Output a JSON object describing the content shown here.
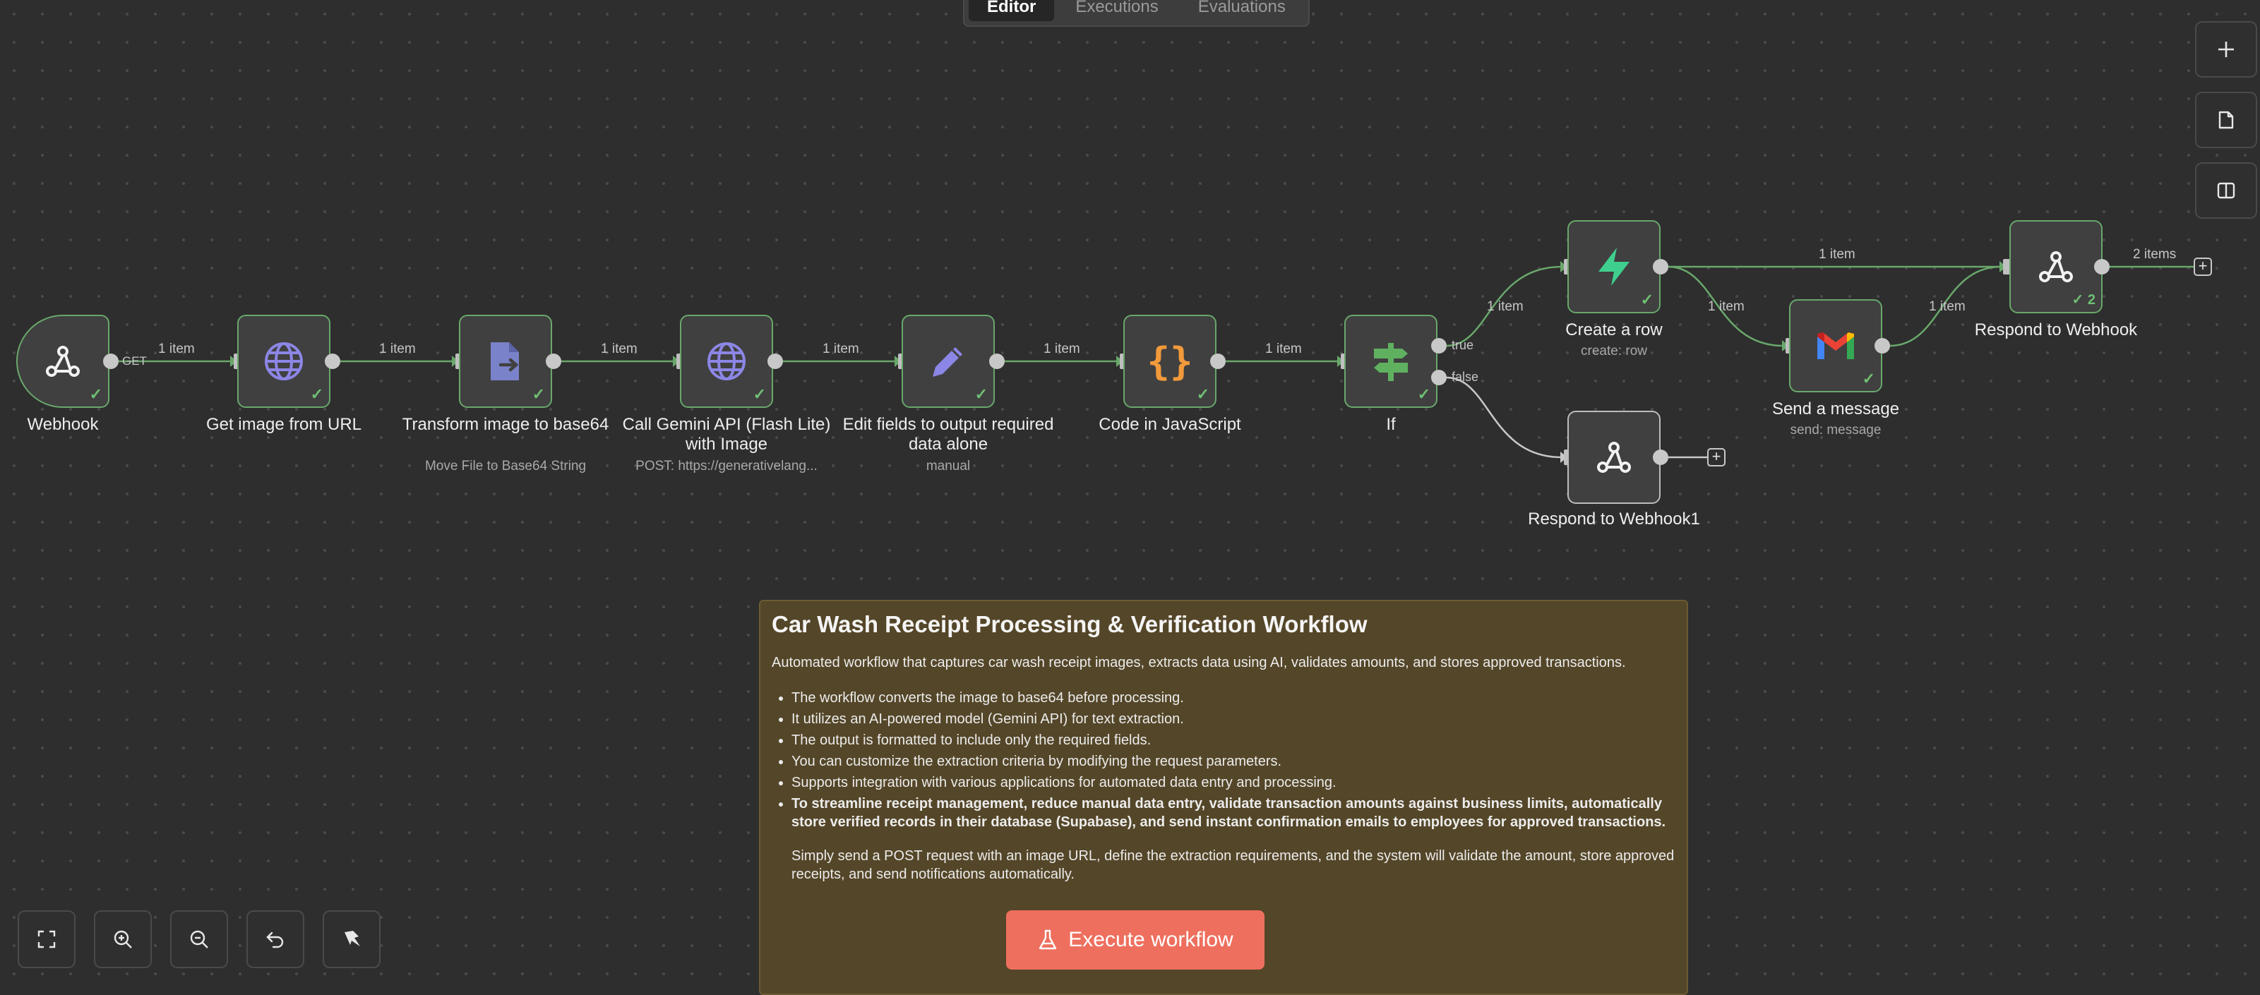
{
  "tabs": [
    "Editor",
    "Executions",
    "Evaluations"
  ],
  "right_toolbar": [
    "plus-icon",
    "sticky-note-icon",
    "panel-toggle-icon"
  ],
  "nodes": {
    "webhook": {
      "label": "Webhook",
      "icon": "webhook-icon"
    },
    "get_image": {
      "label": "Get image from URL",
      "icon": "globe-icon"
    },
    "transform": {
      "label": "Transform image to base64",
      "subtitle": "Move File to Base64 String",
      "icon": "file-convert-icon"
    },
    "gemini": {
      "label": "Call Gemini API (Flash Lite) with Image",
      "subtitle": "POST: https://generativelang...",
      "icon": "globe-icon"
    },
    "edit_fields": {
      "label": "Edit fields to output required data alone",
      "subtitle": "manual",
      "icon": "pencil-icon"
    },
    "code": {
      "label": "Code in JavaScript",
      "icon": "code-braces-icon"
    },
    "if": {
      "label": "If",
      "icon": "signpost-icon",
      "true_label": "true",
      "false_label": "false"
    },
    "create_row": {
      "label": "Create a row",
      "subtitle": "create: row",
      "icon": "supabase-icon"
    },
    "send_message": {
      "label": "Send a message",
      "subtitle": "send: message",
      "icon": "gmail-icon"
    },
    "respond": {
      "label": "Respond to Webhook",
      "runs": "2",
      "icon": "webhook-icon"
    },
    "respond1": {
      "label": "Respond to Webhook1",
      "icon": "webhook-icon"
    }
  },
  "edges": {
    "webhook_method": "GET",
    "e1": "1 item",
    "e2": "1 item",
    "e3": "1 item",
    "e4": "1 item",
    "e5": "1 item",
    "e6": "1 item",
    "if_true": "1 item",
    "create_to_respond": "1 item",
    "create_to_send": "1 item",
    "send_to_respond": "1 item",
    "respond_out": "2 items"
  },
  "sticky": {
    "title": "Car Wash Receipt Processing & Verification Workflow",
    "intro": "Automated workflow that captures car wash receipt images, extracts data using AI, validates amounts, and stores approved transactions.",
    "bullets": [
      "The workflow converts the image to base64 before processing.",
      "It utilizes an AI-powered model (Gemini API) for text extraction.",
      "The output is formatted to include only the required fields.",
      "You can customize the extraction criteria by modifying the request parameters.",
      "Supports integration with various applications for automated data entry and processing."
    ],
    "bold_bullet": "To streamline receipt management, reduce manual data entry, validate transaction amounts against business limits, automatically store verified records in their database (Supabase), and send instant confirmation emails to employees for approved transactions.",
    "tail": "Simply send a POST request with an image URL, define the extraction requirements, and the system will validate the amount, store approved receipts, and send notifications automatically."
  },
  "execute_button": {
    "label": "Execute workflow",
    "icon": "flask-icon"
  },
  "bottom_toolbar": [
    "fit-view-icon",
    "zoom-in-icon",
    "zoom-out-icon",
    "undo-icon",
    "tidy-up-icon"
  ],
  "colors": {
    "accent": "#ee6f5e",
    "success": "#6fbf73",
    "canvas": "#2e2e2e",
    "sticky": "#544628"
  }
}
